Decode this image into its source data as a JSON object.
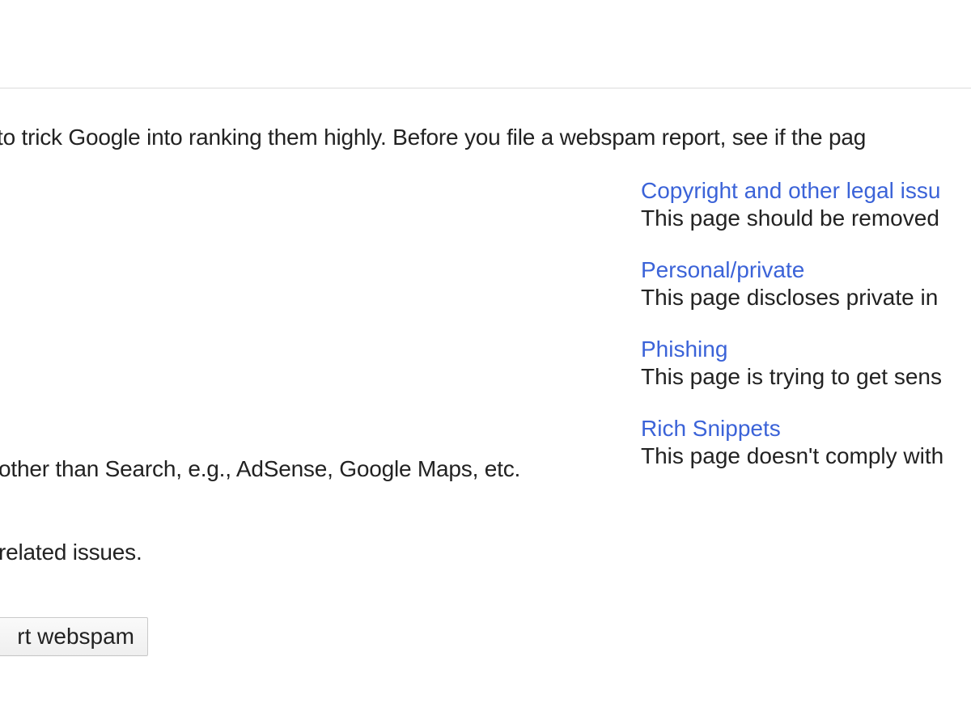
{
  "content": {
    "intro_fragment": "to trick Google into ranking them highly. Before you file a webspam report, see if the pag",
    "left_note_1": "other than Search, e.g., AdSense, Google Maps, etc.",
    "left_note_2": "related issues."
  },
  "issues": [
    {
      "title": "Copyright and other legal issu",
      "description": "This page should be removed"
    },
    {
      "title": "Personal/private",
      "description": "This page discloses private in"
    },
    {
      "title": "Phishing",
      "description": "This page is trying to get sens"
    },
    {
      "title": "Rich Snippets",
      "description": "This page doesn't comply with"
    }
  ],
  "buttons": {
    "report_webspam_label": "rt webspam"
  },
  "colors": {
    "link": "#3b63d8",
    "text": "#222222",
    "divider": "#ececec",
    "background": "#ffffff"
  }
}
